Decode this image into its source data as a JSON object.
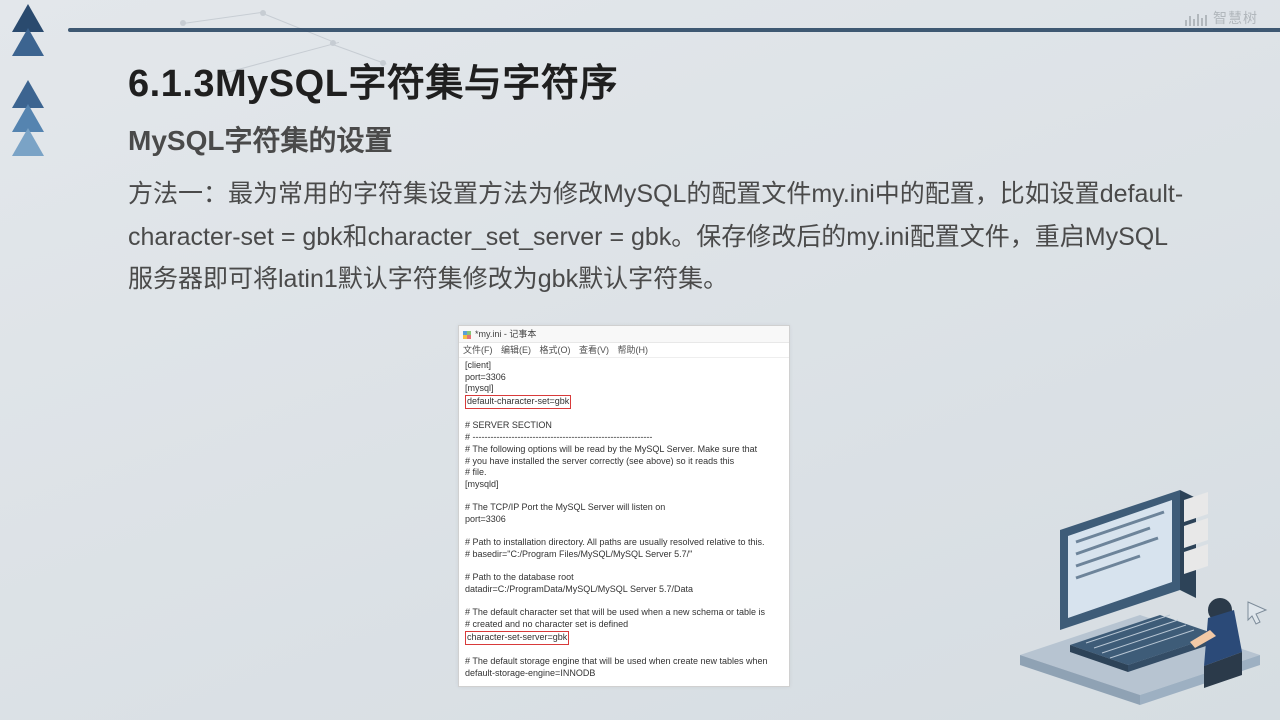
{
  "watermark": {
    "text": "智慧树"
  },
  "slide": {
    "title": "6.1.3MySQL字符集与字符序",
    "subtitle": "MySQL字符集的设置",
    "paragraph": "方法一：最为常用的字符集设置方法为修改MySQL的配置文件my.ini中的配置，比如设置default-character-set = gbk和character_set_server =  gbk。保存修改后的my.ini配置文件，重启MySQL服务器即可将latin1默认字符集修改为gbk默认字符集。"
  },
  "notepad": {
    "window_title": "*my.ini - 记事本",
    "menu": "文件(F)  编辑(E)  格式(O)  查看(V)  帮助(H)",
    "lines_top": "[client]\nport=3306\n[mysql]",
    "highlight1": "default-character-set=gbk",
    "lines_mid": "\n# SERVER SECTION\n# ------------------------------------------------------------\n# The following options will be read by the MySQL Server. Make sure that\n# you have installed the server correctly (see above) so it reads this\n# file.\n[mysqld]\n\n# The TCP/IP Port the MySQL Server will listen on\nport=3306\n\n# Path to installation directory. All paths are usually resolved relative to this.\n# basedir=\"C:/Program Files/MySQL/MySQL Server 5.7/\"\n\n# Path to the database root\ndatadir=C:/ProgramData/MySQL/MySQL Server 5.7/Data\n\n# The default character set that will be used when a new schema or table is\n# created and no character set is defined",
    "highlight2": "character-set-server=gbk",
    "lines_bottom": "\n# The default storage engine that will be used when create new tables when\ndefault-storage-engine=INNODB"
  }
}
